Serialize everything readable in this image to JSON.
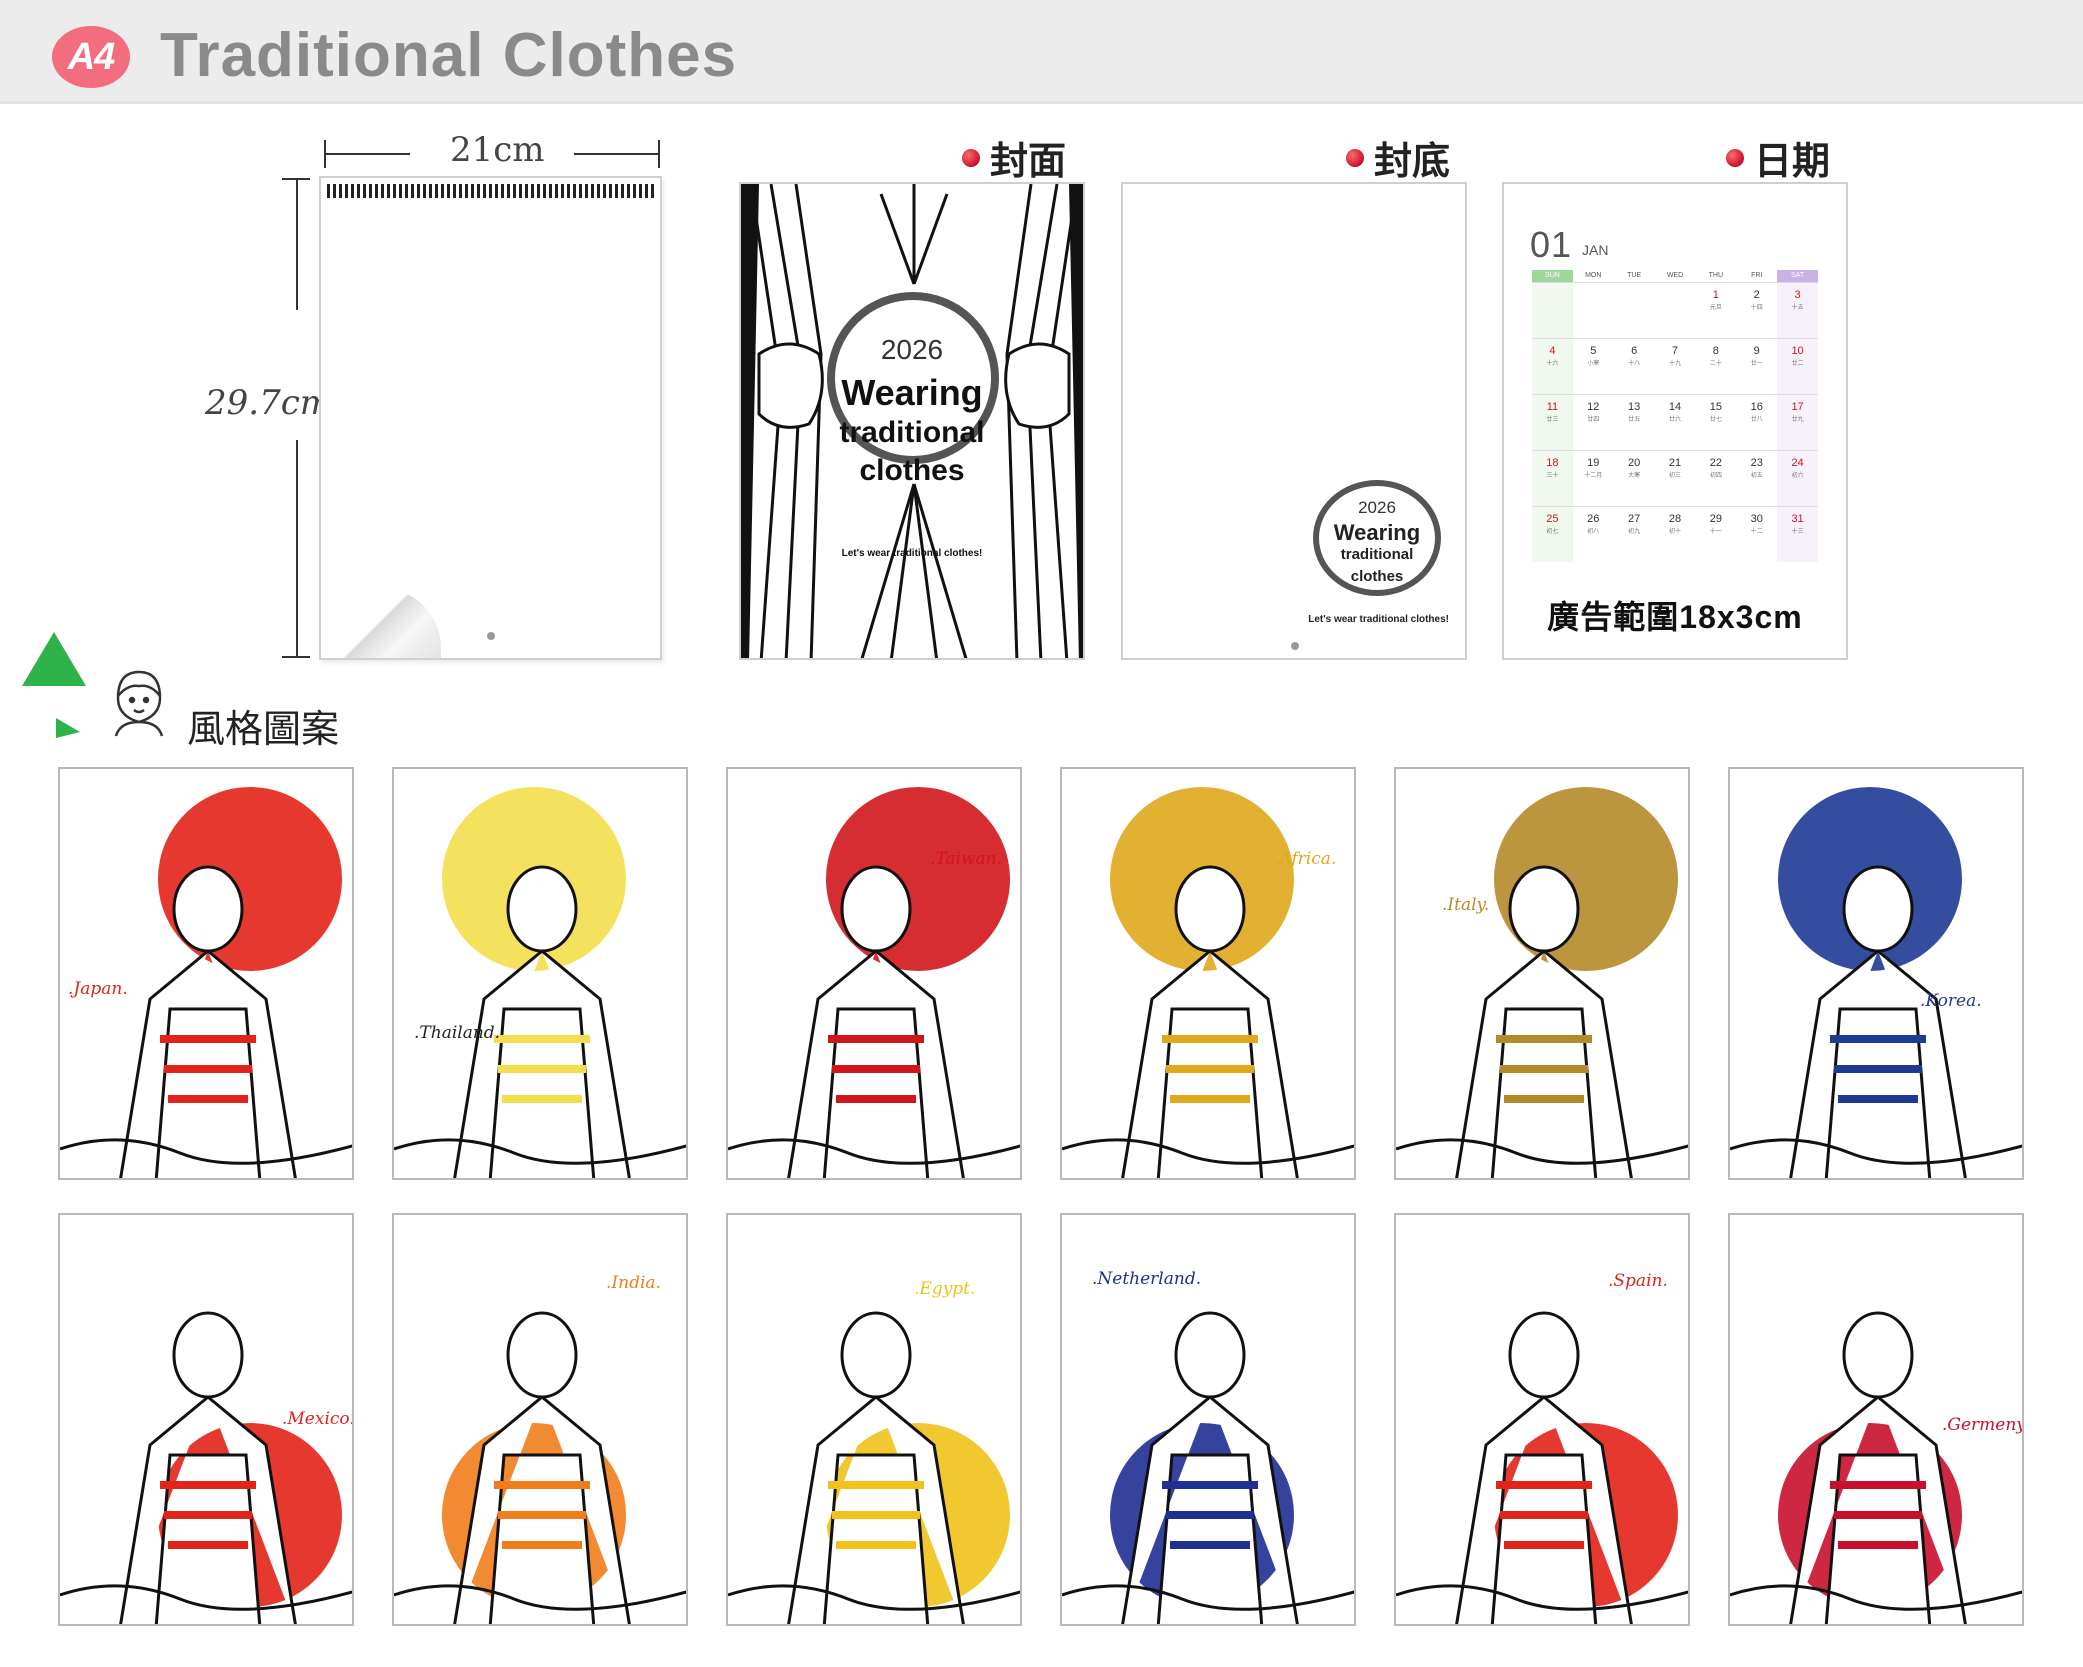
{
  "header": {
    "badge": "A4",
    "title": "Traditional Clothes"
  },
  "dimensions": {
    "width": "21cm",
    "height": "29.7cm"
  },
  "sections": {
    "cover_label": "封面",
    "back_label": "封底",
    "date_label": "日期"
  },
  "cover": {
    "year": "2026",
    "line1": "Wearing",
    "line2": "traditional",
    "line3": "clothes",
    "tagline": "Let's wear traditional clothes!"
  },
  "back": {
    "year": "2026",
    "line1": "Wearing",
    "line2": "traditional",
    "line3": "clothes",
    "tagline": "Let's wear traditional clothes!"
  },
  "calendar": {
    "month_num": "01",
    "month_en": "JAN",
    "weekdays": [
      "SUN",
      "MON",
      "TUE",
      "WED",
      "THU",
      "FRI",
      "SAT"
    ],
    "days": [
      {
        "d": "",
        "l": ""
      },
      {
        "d": "",
        "l": ""
      },
      {
        "d": "",
        "l": ""
      },
      {
        "d": "",
        "l": ""
      },
      {
        "d": "1",
        "l": "元旦"
      },
      {
        "d": "2",
        "l": "十四"
      },
      {
        "d": "3",
        "l": "十五"
      },
      {
        "d": "4",
        "l": "十六"
      },
      {
        "d": "5",
        "l": "小寒"
      },
      {
        "d": "6",
        "l": "十八"
      },
      {
        "d": "7",
        "l": "十九"
      },
      {
        "d": "8",
        "l": "二十"
      },
      {
        "d": "9",
        "l": "廿一"
      },
      {
        "d": "10",
        "l": "廿二"
      },
      {
        "d": "11",
        "l": "廿三"
      },
      {
        "d": "12",
        "l": "廿四"
      },
      {
        "d": "13",
        "l": "廿五"
      },
      {
        "d": "14",
        "l": "廿六"
      },
      {
        "d": "15",
        "l": "廿七"
      },
      {
        "d": "16",
        "l": "廿八"
      },
      {
        "d": "17",
        "l": "廿九"
      },
      {
        "d": "18",
        "l": "三十"
      },
      {
        "d": "19",
        "l": "十二月"
      },
      {
        "d": "20",
        "l": "大寒"
      },
      {
        "d": "21",
        "l": "初三"
      },
      {
        "d": "22",
        "l": "初四"
      },
      {
        "d": "23",
        "l": "初五"
      },
      {
        "d": "24",
        "l": "初六"
      },
      {
        "d": "25",
        "l": "初七"
      },
      {
        "d": "26",
        "l": "初八"
      },
      {
        "d": "27",
        "l": "初九"
      },
      {
        "d": "28",
        "l": "初十"
      },
      {
        "d": "29",
        "l": "十一"
      },
      {
        "d": "30",
        "l": "十二"
      },
      {
        "d": "31",
        "l": "十三"
      }
    ],
    "ad_text": "廣告範圍18x3cm"
  },
  "styles_section": {
    "title": "風格圖案"
  },
  "tiles": [
    {
      "label": ".Japan.",
      "accent": "#e2231a"
    },
    {
      "label": ".Thailand.",
      "accent": "#f3df4d"
    },
    {
      "label": ".Taiwan.",
      "accent": "#d0161b"
    },
    {
      "label": ".Africa.",
      "accent": "#e0a91c"
    },
    {
      "label": ".Italy.",
      "accent": "#b58a2a"
    },
    {
      "label": ".Korea.",
      "accent": "#1f3a93"
    },
    {
      "label": ".Mexico.",
      "accent": "#e2231a"
    },
    {
      "label": ".India.",
      "accent": "#f07d1a"
    },
    {
      "label": ".Egypt.",
      "accent": "#f0c21a"
    },
    {
      "label": ".Netherland.",
      "accent": "#1f2f93"
    },
    {
      "label": ".Spain.",
      "accent": "#e2231a"
    },
    {
      "label": ".Germeny.",
      "accent": "#c8102e"
    }
  ]
}
